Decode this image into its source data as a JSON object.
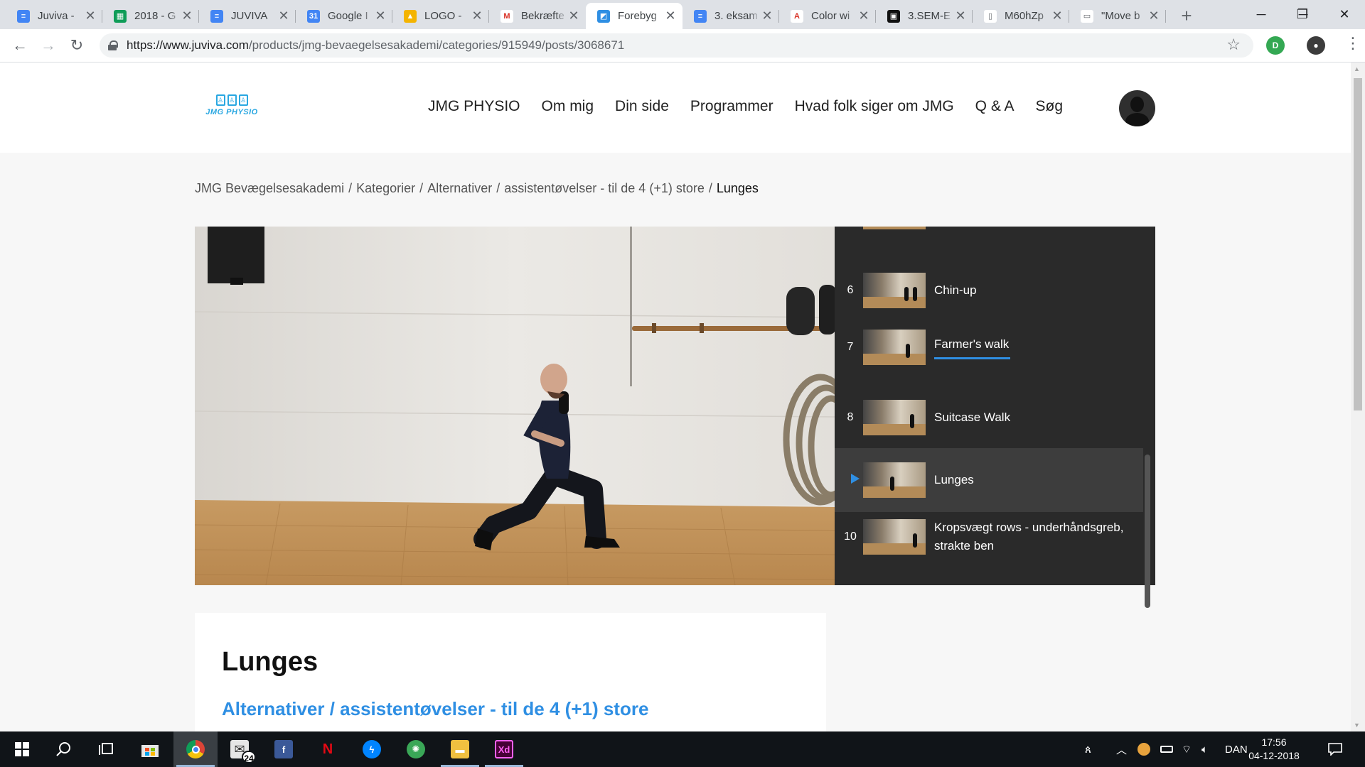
{
  "browser": {
    "tabs": [
      {
        "title": "Juviva -",
        "icon": "docs-icon",
        "color": "#4285f4",
        "glyph": "≡"
      },
      {
        "title": "2018 - G",
        "icon": "sheets-icon",
        "color": "#0f9d58",
        "glyph": "▦"
      },
      {
        "title": "JUVIVA",
        "icon": "docs-icon",
        "color": "#4285f4",
        "glyph": "≡"
      },
      {
        "title": "Google I",
        "icon": "calendar-icon",
        "color": "#4285f4",
        "glyph": "31"
      },
      {
        "title": "LOGO -",
        "icon": "drive-icon",
        "color": "#f4b400",
        "glyph": "▲"
      },
      {
        "title": "Bekræfte",
        "icon": "gmail-icon",
        "color": "#ffffff",
        "glyph": "M"
      },
      {
        "title": "Forebyg",
        "icon": "juviva-icon",
        "color": "#2f8fe3",
        "glyph": "◩"
      },
      {
        "title": "3. eksam",
        "icon": "docs-icon",
        "color": "#4285f4",
        "glyph": "≡"
      },
      {
        "title": "Color wi",
        "icon": "adobe-icon",
        "color": "#ffffff",
        "glyph": "A"
      },
      {
        "title": "3.SEM-E",
        "icon": "app-icon",
        "color": "#111111",
        "glyph": "▣"
      },
      {
        "title": "M60hZp",
        "icon": "file-icon",
        "color": "#ffffff",
        "glyph": "▯"
      },
      {
        "title": "\"Move b",
        "icon": "slides-icon",
        "color": "#ffffff",
        "glyph": "▭"
      }
    ],
    "active_tab": 6,
    "url_host": "https://www.juviva.com",
    "url_path": "/products/jmg-bevaegelsesakademi/categories/915949/posts/3068671",
    "extensions": [
      {
        "icon": "extension-green-icon",
        "color": "#34a853",
        "glyph": "D"
      },
      {
        "icon": "extension-profile-icon",
        "color": "#3c3c3c",
        "glyph": "●"
      }
    ]
  },
  "site": {
    "logo_text": "JMG PHYSIO",
    "nav": [
      "JMG PHYSIO",
      "Om mig",
      "Din side",
      "Programmer",
      "Hvad folk siger om JMG",
      "Q & A",
      "Søg"
    ]
  },
  "breadcrumb": [
    "JMG Bevægelsesakademi",
    "Kategorier",
    "Alternativer",
    "assistentøvelser - til de 4 (+1) store",
    "Lunges"
  ],
  "playlist": [
    {
      "num": "6",
      "title": "Chin-up",
      "state": "normal"
    },
    {
      "num": "7",
      "title": "Farmer's walk",
      "state": "completed"
    },
    {
      "num": "8",
      "title": "Suitcase Walk",
      "state": "normal"
    },
    {
      "num": "",
      "title": "Lunges",
      "state": "current"
    },
    {
      "num": "10",
      "title": "Kropsvægt rows - underhåndsgreb, strakte ben",
      "state": "normal"
    }
  ],
  "lesson": {
    "title": "Lunges",
    "category": "Alternativer / assistentøvelser - til de 4 (+1) store"
  },
  "taskbar": {
    "apps": [
      {
        "icon": "chrome-icon",
        "color": "#db4437",
        "glyph": "◉",
        "state": "active"
      },
      {
        "icon": "mail-icon",
        "color": "#e6e6e6",
        "glyph": "✉",
        "badge": "24",
        "state": ""
      },
      {
        "icon": "facebook-icon",
        "color": "#3b5998",
        "glyph": "f",
        "state": ""
      },
      {
        "icon": "netflix-icon",
        "color": "#101418",
        "glyph": "N",
        "state": ""
      },
      {
        "icon": "messenger-icon",
        "color": "#0084ff",
        "glyph": "ϟ",
        "state": ""
      },
      {
        "icon": "globe-app-icon",
        "color": "#3aa757",
        "glyph": "✺",
        "state": ""
      },
      {
        "icon": "file-explorer-icon",
        "color": "#f0c040",
        "glyph": "▬",
        "state": "running"
      },
      {
        "icon": "adobe-xd-icon",
        "color": "#470137",
        "glyph": "Xd",
        "state": "running"
      }
    ],
    "language": "DAN",
    "time": "17:56",
    "date": "04-12-2018"
  }
}
